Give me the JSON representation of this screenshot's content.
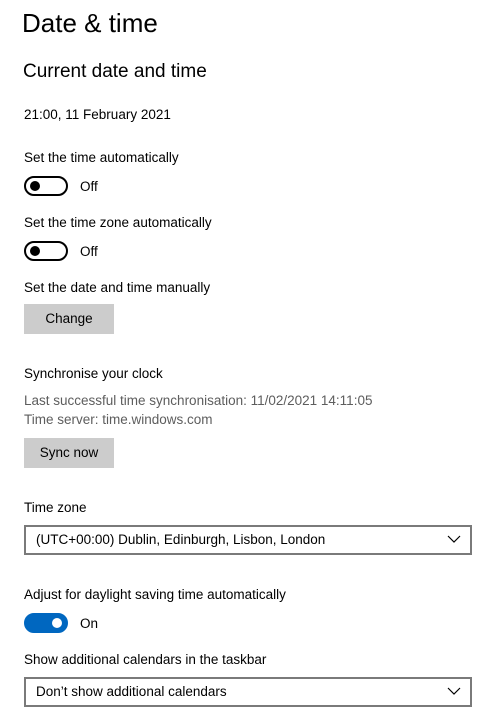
{
  "page": {
    "title": "Date & time",
    "section_title": "Current date and time",
    "current_datetime": "21:00, 11 February 2021"
  },
  "set_time_auto": {
    "label": "Set the time automatically",
    "state": "Off",
    "on": false
  },
  "set_timezone_auto": {
    "label": "Set the time zone automatically",
    "state": "Off",
    "on": false
  },
  "manual": {
    "label": "Set the date and time manually",
    "button": "Change"
  },
  "sync": {
    "heading": "Synchronise your clock",
    "last_sync": "Last successful time synchronisation: 11/02/2021 14:11:05",
    "server": "Time server: time.windows.com",
    "button": "Sync now"
  },
  "timezone": {
    "label": "Time zone",
    "selected": "(UTC+00:00) Dublin, Edinburgh, Lisbon, London"
  },
  "dst": {
    "label": "Adjust for daylight saving time automatically",
    "state": "On",
    "on": true
  },
  "calendars": {
    "label": "Show additional calendars in the taskbar",
    "selected": "Don’t show additional calendars"
  },
  "colors": {
    "accent": "#0067c0",
    "button_bg": "#cccccc",
    "muted_text": "#5d5d5d",
    "select_border": "#7a7a7a"
  },
  "icons": {
    "dropdown": "chevron-down-icon"
  }
}
